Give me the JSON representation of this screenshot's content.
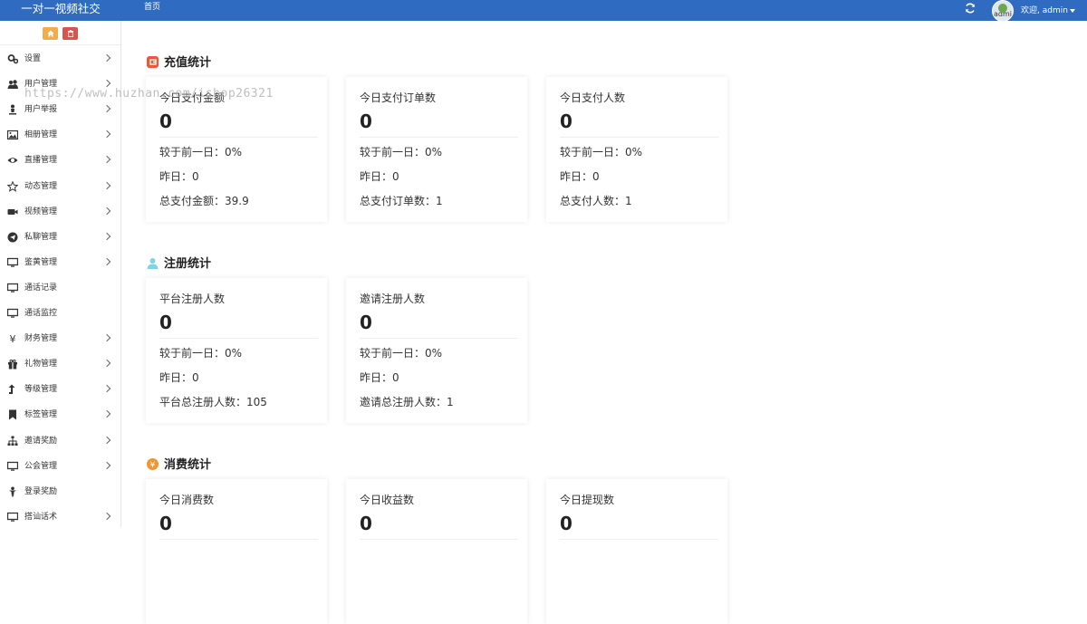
{
  "app": {
    "brand": "一对一视频社交",
    "nav_home": "首页",
    "welcome": "欢迎, admin",
    "avatar_alt": "admi"
  },
  "colors": {
    "topbar": "#2f6cc1",
    "home_button": "#f0ad4e",
    "clear_button": "#d9534f",
    "recharge_icon": "#e8593b",
    "register_icon": "#7fd3e5",
    "consume_icon": "#f0962e"
  },
  "sidebar": {
    "tools": [
      {
        "icon": "home-icon"
      },
      {
        "icon": "trash-icon"
      }
    ],
    "items": [
      {
        "label": "设置",
        "icon": "gears-icon",
        "arrow": true
      },
      {
        "label": "用户管理",
        "icon": "users-icon",
        "arrow": true
      },
      {
        "label": "用户举报",
        "icon": "person-alert-icon",
        "arrow": true
      },
      {
        "label": "相册管理",
        "icon": "picture-icon",
        "arrow": true
      },
      {
        "label": "直播管理",
        "icon": "eye-icon",
        "arrow": true
      },
      {
        "label": "动态管理",
        "icon": "star-icon",
        "arrow": true
      },
      {
        "label": "视频管理",
        "icon": "video-camera-icon",
        "arrow": true
      },
      {
        "label": "私聊管理",
        "icon": "paper-plane-icon",
        "arrow": true
      },
      {
        "label": "鉴黄管理",
        "icon": "desktop-icon",
        "arrow": true
      },
      {
        "label": "通话记录",
        "icon": "desktop-icon",
        "arrow": false
      },
      {
        "label": "通话监控",
        "icon": "desktop-icon",
        "arrow": false
      },
      {
        "label": "财务管理",
        "icon": "yen-icon",
        "arrow": true
      },
      {
        "label": "礼物管理",
        "icon": "gift-icon",
        "arrow": true
      },
      {
        "label": "等级管理",
        "icon": "level-up-icon",
        "arrow": true
      },
      {
        "label": "标签管理",
        "icon": "bookmark-icon",
        "arrow": true
      },
      {
        "label": "邀请奖励",
        "icon": "sitemap-icon",
        "arrow": true
      },
      {
        "label": "公会管理",
        "icon": "desktop-icon",
        "arrow": true
      },
      {
        "label": "登录奖励",
        "icon": "person-icon",
        "arrow": false
      },
      {
        "label": "搭讪话术",
        "icon": "desktop-icon",
        "arrow": true
      }
    ]
  },
  "watermark": "https://www.huzhan.com/ishop26321",
  "sections": [
    {
      "key": "recharge",
      "title": "充值统计",
      "icon": "wallet-icon",
      "cards": [
        {
          "title": "今日支付金额",
          "value": "0",
          "lines": [
            "较于前一日：0%",
            "昨日：0",
            "总支付金额：39.9"
          ]
        },
        {
          "title": "今日支付订单数",
          "value": "0",
          "lines": [
            "较于前一日：0%",
            "昨日：0",
            "总支付订单数：1"
          ]
        },
        {
          "title": "今日支付人数",
          "value": "0",
          "lines": [
            "较于前一日：0%",
            "昨日：0",
            "总支付人数：1"
          ]
        }
      ]
    },
    {
      "key": "register",
      "title": "注册统计",
      "icon": "user-icon",
      "cards": [
        {
          "title": "平台注册人数",
          "value": "0",
          "lines": [
            "较于前一日：0%",
            "昨日：0",
            "平台总注册人数：105"
          ]
        },
        {
          "title": "邀请注册人数",
          "value": "0",
          "lines": [
            "较于前一日：0%",
            "昨日：0",
            "邀请总注册人数：1"
          ]
        }
      ]
    },
    {
      "key": "consume",
      "title": "消费统计",
      "icon": "yen-circle-icon",
      "cards": [
        {
          "title": "今日消费数",
          "value": "0",
          "lines": []
        },
        {
          "title": "今日收益数",
          "value": "0",
          "lines": []
        },
        {
          "title": "今日提现数",
          "value": "0",
          "lines": []
        }
      ]
    }
  ]
}
